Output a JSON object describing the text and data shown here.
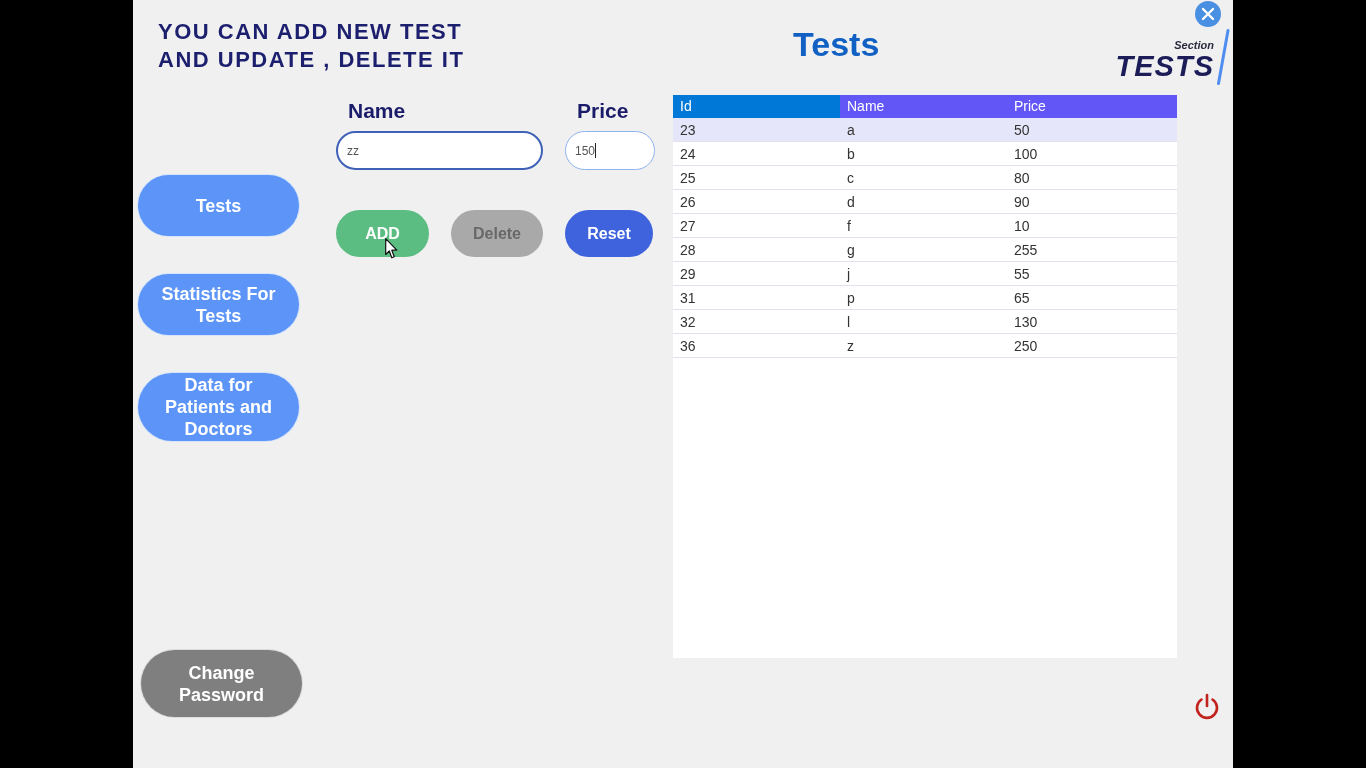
{
  "header": {
    "instructions": [
      "YOU CAN ADD NEW TEST",
      "AND UPDATE , DELETE IT"
    ],
    "title": "Tests",
    "section_logo": {
      "caption": "Section",
      "name": "TESTS"
    }
  },
  "sidebar": {
    "items": [
      {
        "label": "Tests"
      },
      {
        "label": "Statistics For Tests"
      },
      {
        "label": "Data for Patients and Doctors"
      }
    ],
    "footer_button": {
      "label": "Change Password"
    }
  },
  "form": {
    "fields": [
      {
        "label": "Name",
        "value": "zz",
        "focused": false
      },
      {
        "label": "Price",
        "value": "150",
        "focused": true
      }
    ],
    "actions": [
      {
        "label": "ADD",
        "kind": "add",
        "disabled": false
      },
      {
        "label": "Delete",
        "kind": "delete",
        "disabled": true
      },
      {
        "label": "Reset",
        "kind": "reset",
        "disabled": false
      }
    ]
  },
  "table": {
    "columns": [
      {
        "label": "Id",
        "selected": true
      },
      {
        "label": "Name",
        "selected": false
      },
      {
        "label": "Price",
        "selected": false
      }
    ],
    "rows": [
      {
        "cells": [
          "23",
          "a",
          "50"
        ],
        "selected": true
      },
      {
        "cells": [
          "24",
          "b",
          "100"
        ],
        "selected": false
      },
      {
        "cells": [
          "25",
          "c",
          "80"
        ],
        "selected": false
      },
      {
        "cells": [
          "26",
          "d",
          "90"
        ],
        "selected": false
      },
      {
        "cells": [
          "27",
          "f",
          "10"
        ],
        "selected": false
      },
      {
        "cells": [
          "28",
          "g",
          "255"
        ],
        "selected": false
      },
      {
        "cells": [
          "29",
          "j",
          "55"
        ],
        "selected": false
      },
      {
        "cells": [
          "31",
          "p",
          "65"
        ],
        "selected": false
      },
      {
        "cells": [
          "32",
          "l",
          "130"
        ],
        "selected": false
      },
      {
        "cells": [
          "36",
          "z",
          "250"
        ],
        "selected": false
      }
    ]
  }
}
